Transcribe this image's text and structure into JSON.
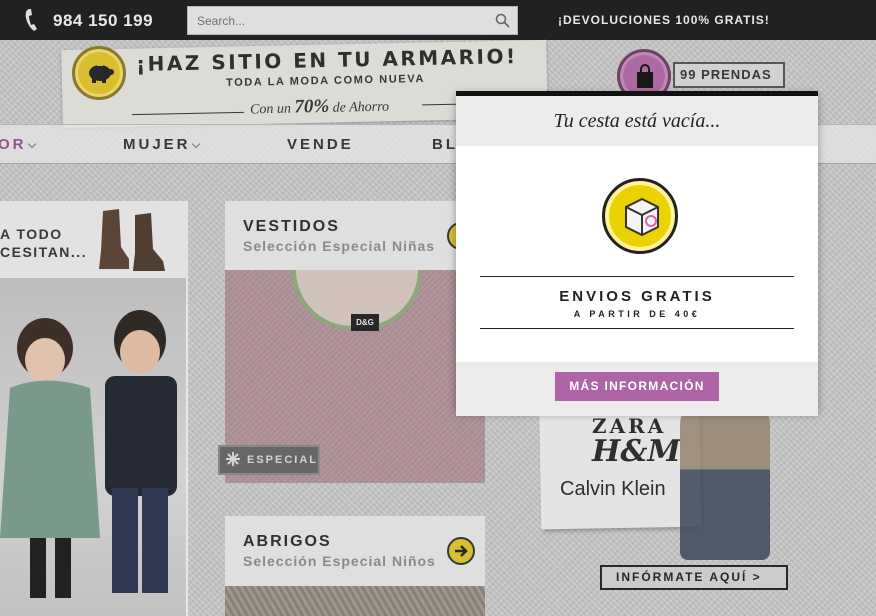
{
  "topbar": {
    "phone": "984 150 199",
    "search_placeholder": "Search...",
    "returns": "¡DEVOLUCIONES 100% GRATIS!"
  },
  "banner": {
    "title": "¡HAZ SITIO EN TU ARMARIO!",
    "subtitle": "TODA LA MODA COMO NUEVA",
    "saving_prefix": "Con un",
    "saving_value": "70%",
    "saving_suffix": "de Ahorro"
  },
  "bag": {
    "count_label": "99 PRENDAS"
  },
  "nav": {
    "items": [
      {
        "label": "OR"
      },
      {
        "label": "MUJER"
      },
      {
        "label": "VENDE"
      },
      {
        "label": "BL"
      }
    ]
  },
  "left_card": {
    "line1": "A TODO",
    "line2": "CESITAN..."
  },
  "tiles": [
    {
      "title": "VESTIDOS",
      "subtitle": "Selección Especial Niñas",
      "badge": "ESPECIAL",
      "tag": "D&G"
    },
    {
      "title": "ABRIGOS",
      "subtitle": "Selección Especial Niños"
    }
  ],
  "brands_card": {
    "brands": [
      "ZARA",
      "H&M",
      "Calvin Klein"
    ],
    "cta": "INFÓRMATE AQUÍ >"
  },
  "cart_popup": {
    "empty_message": "Tu cesta está vacía...",
    "shipping_title": "ENVIOS GRATIS",
    "shipping_sub": "A PARTIR DE 40€",
    "button_label": "MÁS INFORMACIÓN"
  },
  "colors": {
    "accent_purple": "#b064a8",
    "accent_yellow": "#ecd200",
    "topbar_bg": "#1b1b1b"
  },
  "icons": [
    "phone-icon",
    "search-icon",
    "piggy-bank-icon",
    "shopping-bag-icon",
    "box-icon",
    "arrow-right-icon",
    "snowflake-icon"
  ]
}
